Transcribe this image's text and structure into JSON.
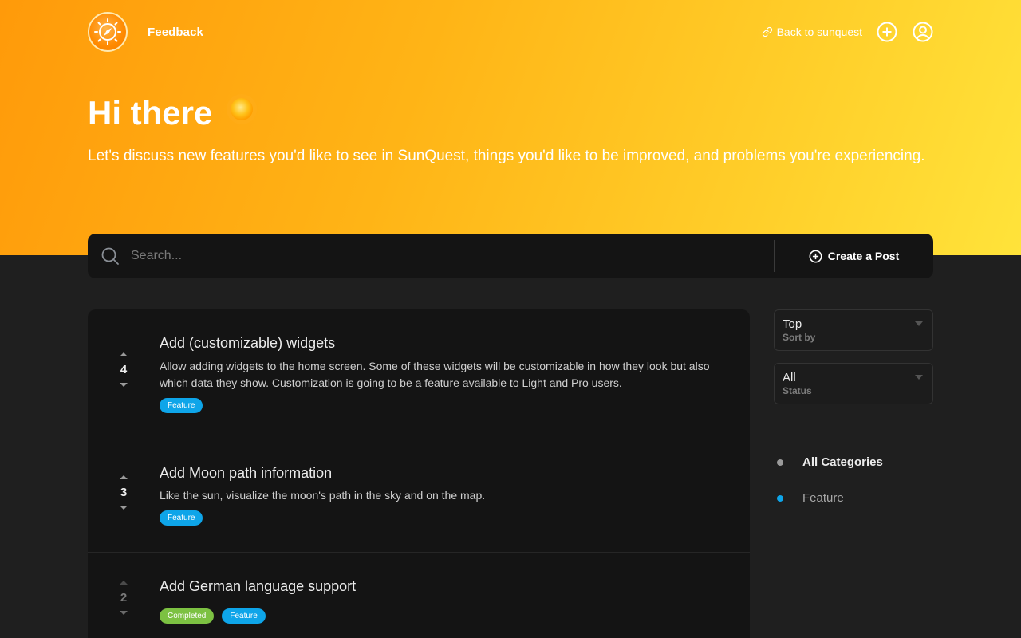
{
  "header": {
    "brand": "Feedback",
    "back_link": "Back to sunquest"
  },
  "hero": {
    "title": "Hi there",
    "emoji": "☀️",
    "subtitle": "Let's discuss new features you'd like to see in SunQuest, things you'd like to be improved, and problems you're experiencing."
  },
  "search": {
    "placeholder": "Search...",
    "create_label": "Create a Post"
  },
  "posts": [
    {
      "votes": "4",
      "title": "Add (customizable) widgets",
      "description": "Allow adding widgets to the home screen. Some of these widgets will be customizable in how they look but also which data they show. Customization is going to be a feature available to Light and Pro users.",
      "tags": [
        "Feature"
      ]
    },
    {
      "votes": "3",
      "title": "Add Moon path information",
      "description": "Like the sun, visualize the moon's path in the sky and on the map.",
      "tags": [
        "Feature"
      ]
    },
    {
      "votes": "2",
      "title": "Add German language support",
      "description": "",
      "tags": [
        "Completed",
        "Feature"
      ]
    }
  ],
  "filters": {
    "sort": {
      "value": "Top",
      "label": "Sort by"
    },
    "status": {
      "value": "All",
      "label": "Status"
    }
  },
  "categories": [
    {
      "label": "All Categories",
      "color": "#9a9a9a"
    },
    {
      "label": "Feature",
      "color": "#0ea5e9"
    }
  ],
  "colors": {
    "tag_feature": "#0ea5e9",
    "tag_completed": "#7cc142",
    "hero_gradient_start": "#ff9a0a",
    "hero_gradient_end": "#ffe33a"
  }
}
